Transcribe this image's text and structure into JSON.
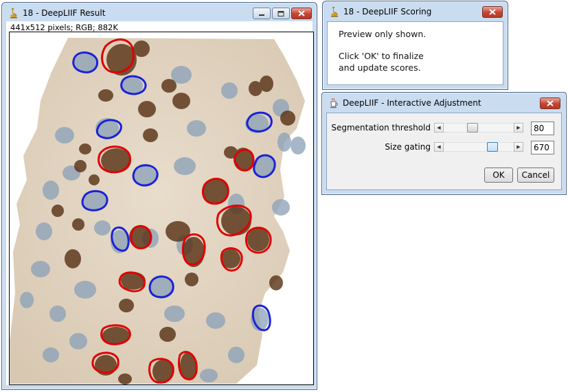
{
  "result_window": {
    "title": "18 - DeepLIIF Result",
    "info": "441x512 pixels; RGB; 882K"
  },
  "scoring_window": {
    "title": "18 - DeepLIIF Scoring",
    "line1": "Preview only shown.",
    "line2": "Click 'OK' to finalize",
    "line3": "and update scores."
  },
  "adjust_window": {
    "title": "DeepLIIF - Interactive Adjustment",
    "seg_label": "Segmentation threshold",
    "seg_value": "80",
    "size_label": "Size gating",
    "size_value": "670",
    "ok_label": "OK",
    "cancel_label": "Cancel"
  },
  "icons": {
    "app": "microscope-icon",
    "java": "java-cup-icon",
    "minimize": "minimize-icon",
    "maximize": "maximize-icon",
    "close": "close-icon",
    "left_arrow": "arrow-left-icon",
    "right_arrow": "arrow-right-icon"
  },
  "colors": {
    "positive_outline": "#e00000",
    "negative_outline": "#1a22d8",
    "title_bar": "#c9dcf0",
    "close_button": "#c4442f"
  }
}
